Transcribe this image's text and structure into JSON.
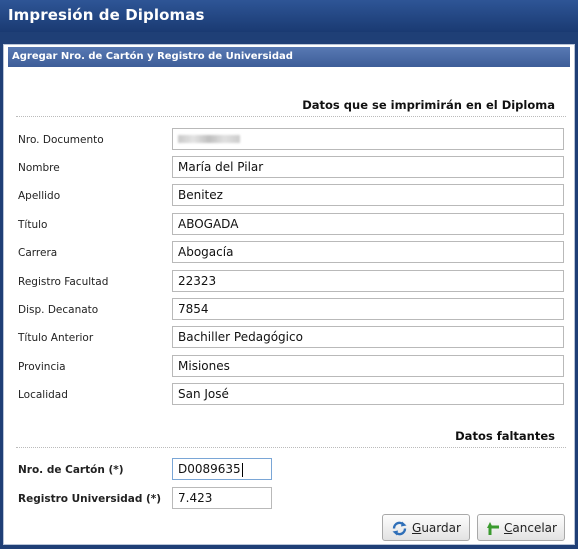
{
  "window": {
    "title": "Impresión de Diplomas"
  },
  "panel": {
    "title": "Agregar Nro. de Cartón y Registro de Universidad"
  },
  "section1": {
    "title": "Datos que se imprimirán en el Diploma"
  },
  "fields": [
    {
      "label": "Nro. Documento",
      "value": ""
    },
    {
      "label": "Nombre",
      "value": "María del Pilar"
    },
    {
      "label": "Apellido",
      "value": "Benitez"
    },
    {
      "label": "Título",
      "value": "ABOGADA"
    },
    {
      "label": "Carrera",
      "value": "Abogacía"
    },
    {
      "label": "Registro Facultad",
      "value": "22323"
    },
    {
      "label": "Disp. Decanato",
      "value": "7854"
    },
    {
      "label": "Título Anterior",
      "value": "Bachiller Pedagógico"
    },
    {
      "label": "Provincia",
      "value": "Misiones"
    },
    {
      "label": "Localidad",
      "value": "San José"
    }
  ],
  "section2": {
    "title": "Datos faltantes"
  },
  "missing": {
    "carton": {
      "label": "Nro. de Cartón (*)",
      "value": "D0089635"
    },
    "registro": {
      "label": "Registro Universidad (*)",
      "value": "7.423"
    }
  },
  "buttons": {
    "save": {
      "prefix": "",
      "underline": "G",
      "rest": "uardar",
      "icon": "refresh-icon"
    },
    "cancel": {
      "prefix": "",
      "underline": "C",
      "rest": "ancelar",
      "icon": "green-arrow-icon"
    }
  }
}
